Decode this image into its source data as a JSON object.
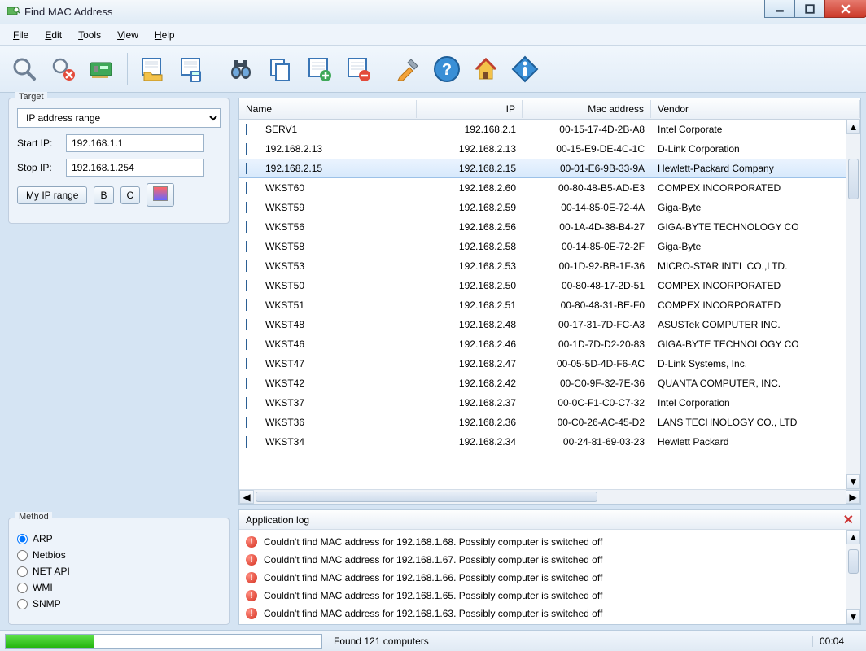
{
  "window": {
    "title": "Find MAC Address"
  },
  "menu": {
    "file": "File",
    "edit": "Edit",
    "tools": "Tools",
    "view": "View",
    "help": "Help"
  },
  "target": {
    "legend": "Target",
    "select": "IP address range",
    "start_label": "Start IP:",
    "start_value": "192.168.1.1",
    "stop_label": "Stop IP:",
    "stop_value": "192.168.1.254",
    "my_ip": "My IP range",
    "b": "B",
    "c": "C"
  },
  "method": {
    "legend": "Method",
    "options": [
      "ARP",
      "Netbios",
      "NET API",
      "WMI",
      "SNMP"
    ],
    "selected": "ARP"
  },
  "table": {
    "columns": {
      "name": "Name",
      "ip": "IP",
      "mac": "Mac address",
      "vendor": "Vendor"
    },
    "selected_index": 2,
    "rows": [
      {
        "name": "SERV1",
        "ip": "192.168.2.1",
        "mac": "00-15-17-4D-2B-A8",
        "vendor": "Intel Corporate"
      },
      {
        "name": "192.168.2.13",
        "ip": "192.168.2.13",
        "mac": "00-15-E9-DE-4C-1C",
        "vendor": "D-Link Corporation"
      },
      {
        "name": "192.168.2.15",
        "ip": "192.168.2.15",
        "mac": "00-01-E6-9B-33-9A",
        "vendor": "Hewlett-Packard Company"
      },
      {
        "name": "WKST60",
        "ip": "192.168.2.60",
        "mac": "00-80-48-B5-AD-E3",
        "vendor": "COMPEX INCORPORATED"
      },
      {
        "name": "WKST59",
        "ip": "192.168.2.59",
        "mac": "00-14-85-0E-72-4A",
        "vendor": "Giga-Byte"
      },
      {
        "name": "WKST56",
        "ip": "192.168.2.56",
        "mac": "00-1A-4D-38-B4-27",
        "vendor": "GIGA-BYTE TECHNOLOGY CO"
      },
      {
        "name": "WKST58",
        "ip": "192.168.2.58",
        "mac": "00-14-85-0E-72-2F",
        "vendor": "Giga-Byte"
      },
      {
        "name": "WKST53",
        "ip": "192.168.2.53",
        "mac": "00-1D-92-BB-1F-36",
        "vendor": "MICRO-STAR INT'L CO.,LTD."
      },
      {
        "name": "WKST50",
        "ip": "192.168.2.50",
        "mac": "00-80-48-17-2D-51",
        "vendor": "COMPEX INCORPORATED"
      },
      {
        "name": "WKST51",
        "ip": "192.168.2.51",
        "mac": "00-80-48-31-BE-F0",
        "vendor": "COMPEX INCORPORATED"
      },
      {
        "name": "WKST48",
        "ip": "192.168.2.48",
        "mac": "00-17-31-7D-FC-A3",
        "vendor": "ASUSTek COMPUTER INC."
      },
      {
        "name": "WKST46",
        "ip": "192.168.2.46",
        "mac": "00-1D-7D-D2-20-83",
        "vendor": "GIGA-BYTE TECHNOLOGY CO"
      },
      {
        "name": "WKST47",
        "ip": "192.168.2.47",
        "mac": "00-05-5D-4D-F6-AC",
        "vendor": "D-Link Systems, Inc."
      },
      {
        "name": "WKST42",
        "ip": "192.168.2.42",
        "mac": "00-C0-9F-32-7E-36",
        "vendor": "QUANTA COMPUTER, INC."
      },
      {
        "name": "WKST37",
        "ip": "192.168.2.37",
        "mac": "00-0C-F1-C0-C7-32",
        "vendor": "Intel Corporation"
      },
      {
        "name": "WKST36",
        "ip": "192.168.2.36",
        "mac": "00-C0-26-AC-45-D2",
        "vendor": "LANS TECHNOLOGY CO., LTD"
      },
      {
        "name": "WKST34",
        "ip": "192.168.2.34",
        "mac": "00-24-81-69-03-23",
        "vendor": "Hewlett Packard"
      }
    ]
  },
  "log": {
    "title": "Application log",
    "lines": [
      "Couldn't find MAC address for 192.168.1.68. Possibly computer is switched off",
      "Couldn't find MAC address for 192.168.1.67. Possibly computer is switched off",
      "Couldn't find MAC address for 192.168.1.66. Possibly computer is switched off",
      "Couldn't find MAC address for 192.168.1.65. Possibly computer is switched off",
      "Couldn't find MAC address for 192.168.1.63. Possibly computer is switched off"
    ]
  },
  "status": {
    "text": "Found 121 computers",
    "time": "00:04",
    "progress_pct": 28
  }
}
